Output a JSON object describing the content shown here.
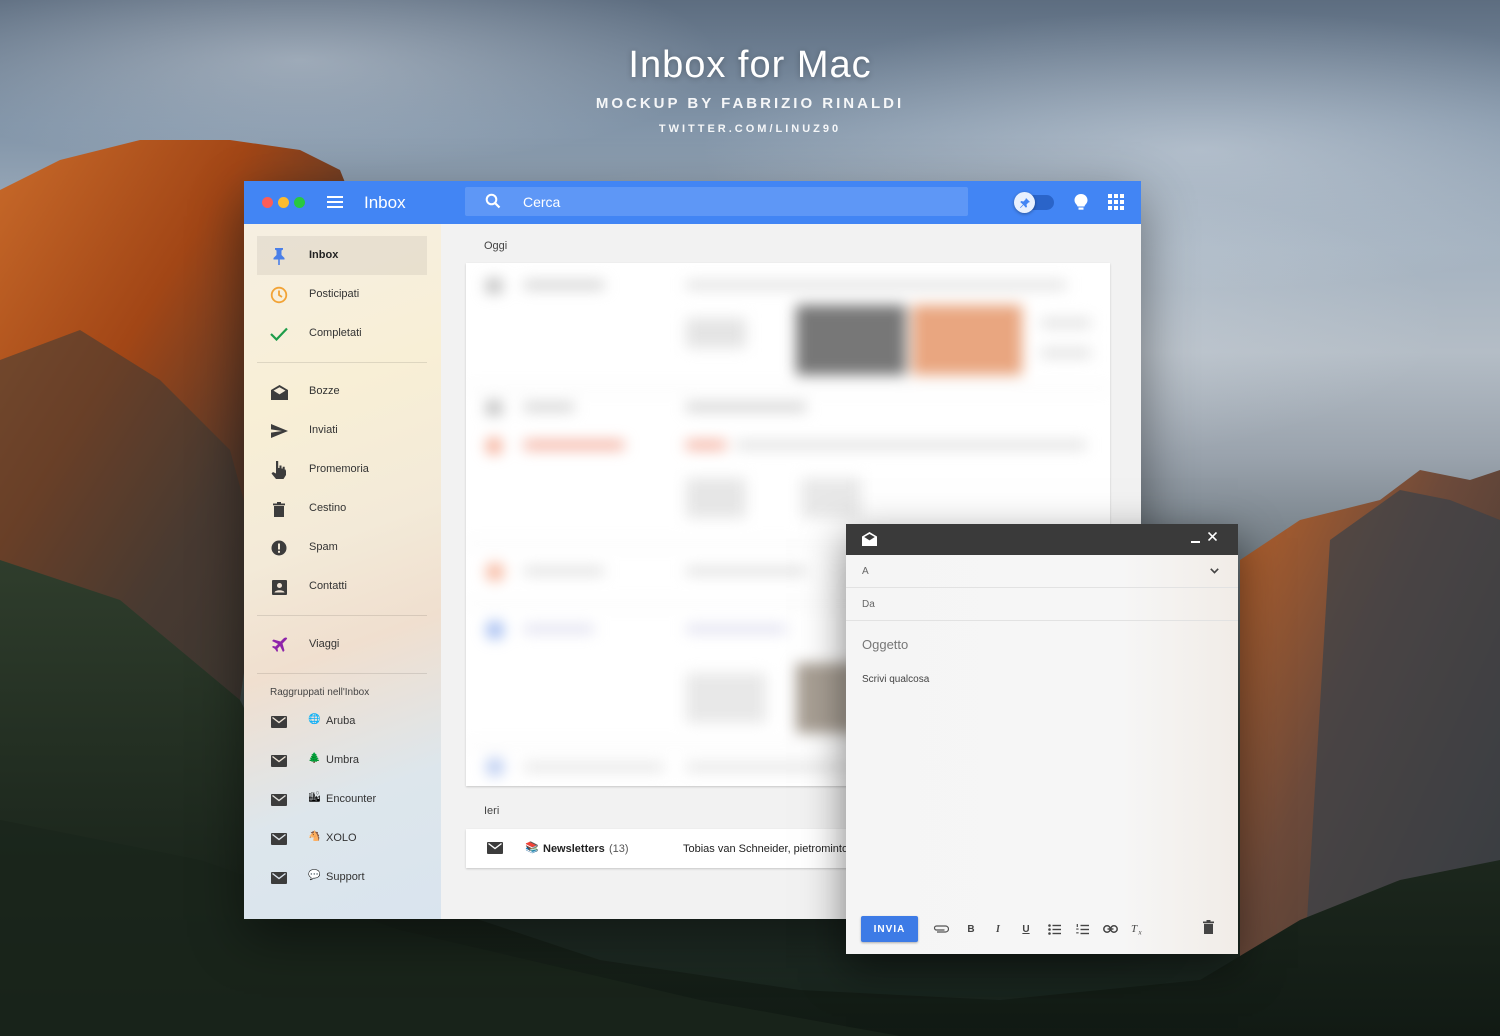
{
  "hero": {
    "title_bold": "Inbox",
    "title_rest": " for Mac",
    "subtitle": "MOCKUP BY FABRIZIO RINALDI",
    "link": "TWITTER.COM/LINUZ90"
  },
  "topbar": {
    "app_title": "Inbox",
    "search_placeholder": "Cerca",
    "accent_color": "#4285f4"
  },
  "sidebar": {
    "items": [
      {
        "label": "Inbox",
        "icon": "pin-icon",
        "active": true
      },
      {
        "label": "Posticipati",
        "icon": "clock-icon"
      },
      {
        "label": "Completati",
        "icon": "check-icon"
      },
      {
        "label": "Bozze",
        "icon": "drafts-icon"
      },
      {
        "label": "Inviati",
        "icon": "send-icon"
      },
      {
        "label": "Promemoria",
        "icon": "reminder-hand-icon"
      },
      {
        "label": "Cestino",
        "icon": "trash-icon"
      },
      {
        "label": "Spam",
        "icon": "spam-icon"
      },
      {
        "label": "Contatti",
        "icon": "contacts-icon"
      },
      {
        "label": "Viaggi",
        "icon": "plane-icon"
      }
    ],
    "group_heading": "Raggruppati nell'Inbox",
    "groups": [
      {
        "label": "Aruba",
        "emoji": "🌐"
      },
      {
        "label": "Umbra",
        "emoji": "🌲"
      },
      {
        "label": "Encounter",
        "emoji": "🏙"
      },
      {
        "label": "XOLO",
        "emoji": "🐴"
      },
      {
        "label": "Support",
        "emoji": "💬"
      }
    ]
  },
  "content": {
    "today_label": "Oggi",
    "yesterday_label": "Ieri",
    "yesterday_row": {
      "emoji": "📚",
      "name": "Newsletters",
      "count": "(13)",
      "senders": "Tobias van Schneider, pietrominto"
    }
  },
  "compose": {
    "to_placeholder": "A",
    "from_placeholder": "Da",
    "subject_placeholder": "Oggetto",
    "body_placeholder": "Scrivi qualcosa",
    "send_label": "INVIA",
    "format_bold": "B",
    "format_italic": "I",
    "format_underline": "U"
  }
}
